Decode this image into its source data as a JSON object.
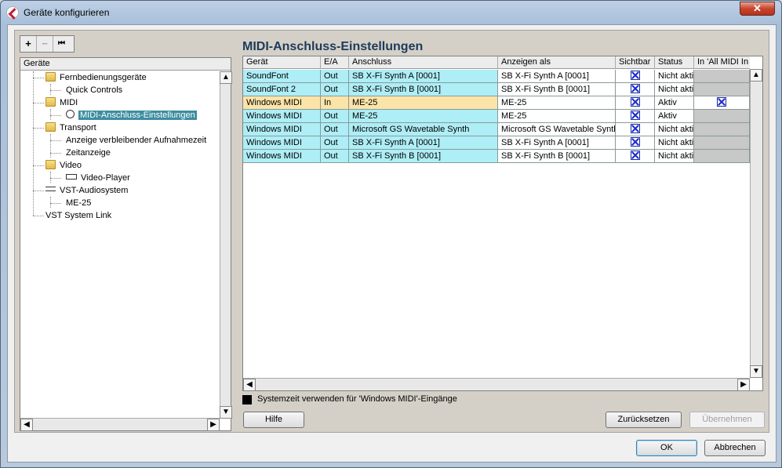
{
  "window": {
    "title": "Geräte konfigurieren",
    "close_glyph": "✕"
  },
  "toolbar": {
    "add": "+",
    "remove": "−",
    "first": "⏮"
  },
  "tree": {
    "header": "Geräte",
    "items": [
      {
        "label": "Fernbedienungsgeräte"
      },
      {
        "label": "Quick Controls"
      },
      {
        "label": "MIDI"
      },
      {
        "label": "MIDI-Anschluss-Einstellungen"
      },
      {
        "label": "Transport"
      },
      {
        "label": "Anzeige verbleibender Aufnahmezeit"
      },
      {
        "label": "Zeitanzeige"
      },
      {
        "label": "Video"
      },
      {
        "label": "Video-Player"
      },
      {
        "label": "VST-Audiosystem"
      },
      {
        "label": "ME-25"
      },
      {
        "label": "VST System Link"
      }
    ]
  },
  "main": {
    "title": "MIDI-Anschluss-Einstellungen",
    "columns": [
      "Gerät",
      "E/A",
      "Anschluss",
      "Anzeigen als",
      "Sichtbar",
      "Status",
      "In 'All MIDI In"
    ],
    "rows": [
      {
        "device": "SoundFont",
        "io": "Out",
        "port": "SB X-Fi Synth A [0001]",
        "show_as": "SB X-Fi Synth A [0001]",
        "visible": true,
        "status": "Nicht aktiv",
        "all_midi": null
      },
      {
        "device": "SoundFont 2",
        "io": "Out",
        "port": "SB X-Fi Synth B [0001]",
        "show_as": "SB X-Fi Synth B [0001]",
        "visible": true,
        "status": "Nicht aktiv",
        "all_midi": null
      },
      {
        "device": "Windows MIDI",
        "io": "In",
        "port": "ME-25",
        "show_as": "ME-25",
        "visible": true,
        "status": "Aktiv",
        "all_midi": true
      },
      {
        "device": "Windows MIDI",
        "io": "Out",
        "port": "ME-25",
        "show_as": "ME-25",
        "visible": true,
        "status": "Aktiv",
        "all_midi": null
      },
      {
        "device": "Windows MIDI",
        "io": "Out",
        "port": "Microsoft GS Wavetable Synth",
        "show_as": "Microsoft GS Wavetable Synth",
        "visible": true,
        "status": "Nicht aktiv",
        "all_midi": null
      },
      {
        "device": "Windows MIDI",
        "io": "Out",
        "port": "SB X-Fi Synth A [0001]",
        "show_as": "SB X-Fi Synth A [0001]",
        "visible": true,
        "status": "Nicht aktiv",
        "all_midi": null
      },
      {
        "device": "Windows MIDI",
        "io": "Out",
        "port": "SB X-Fi Synth B [0001]",
        "show_as": "SB X-Fi Synth B [0001]",
        "visible": true,
        "status": "Nicht aktiv",
        "all_midi": null
      }
    ],
    "system_time_label": "Systemzeit verwenden für 'Windows MIDI'-Eingänge",
    "system_time_checked": true
  },
  "buttons": {
    "help": "Hilfe",
    "reset": "Zurücksetzen",
    "apply": "Übernehmen",
    "ok": "OK",
    "cancel": "Abbrechen"
  },
  "colors": {
    "row_out": "#aeeef6",
    "row_in": "#fbe4a8",
    "cell_disabled": "#c8c8c8",
    "selection": "#3d8da1"
  }
}
